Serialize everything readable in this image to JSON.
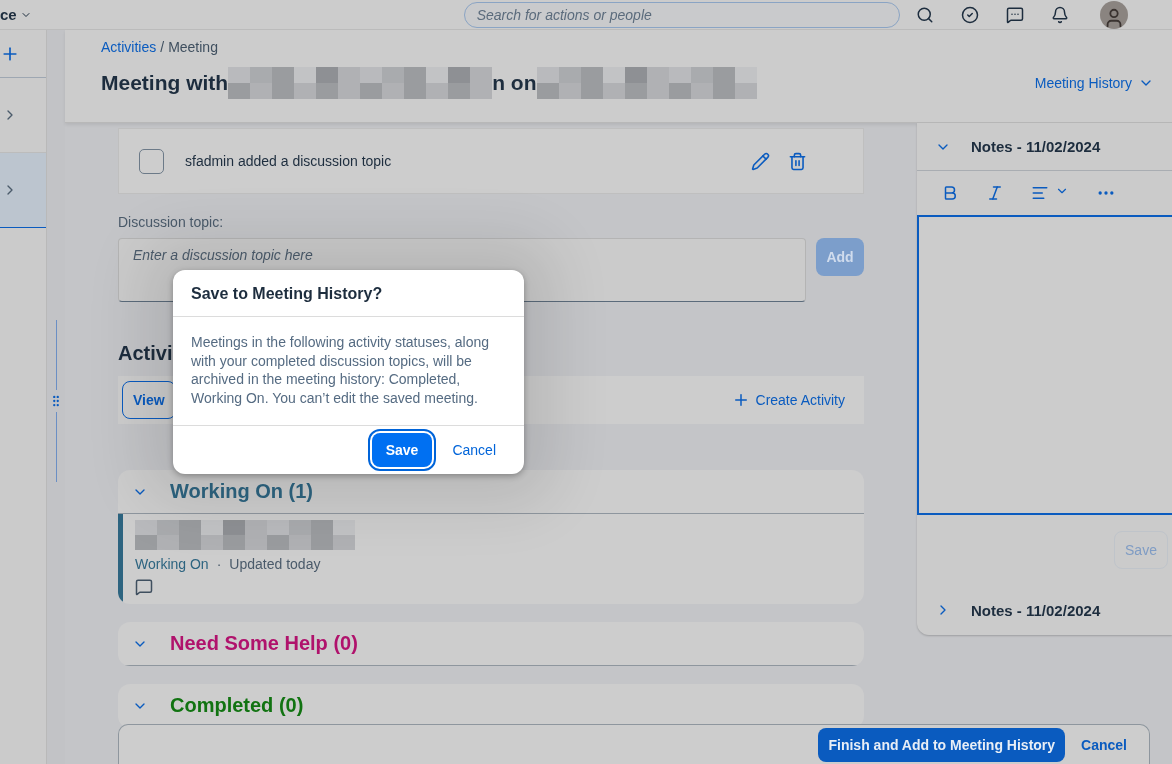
{
  "shell": {
    "title": "ce",
    "search": {
      "placeholder": "Search for actions or people"
    }
  },
  "sidebar": {
    "items": [
      {
        "selected": false
      },
      {
        "selected": true
      }
    ]
  },
  "breadcrumb": {
    "items": [
      {
        "label": "Activities",
        "link": true
      },
      {
        "label": "Meeting",
        "link": false
      }
    ],
    "separator": "/"
  },
  "title": {
    "lead": "Meeting with",
    "middle": "n on"
  },
  "history_menu": {
    "label": "Meeting History"
  },
  "topics": [
    {
      "text": "sfadmin added a discussion topic",
      "checked": false
    }
  ],
  "discussion": {
    "label": "Discussion topic:",
    "placeholder": "Enter a discussion topic here",
    "add_button": {
      "label": "Add",
      "disabled": true
    }
  },
  "activities": {
    "heading": "Activi",
    "view_button": "View",
    "create_button": "Create Activity"
  },
  "groups": [
    {
      "title": "Working On (1)",
      "color": "#2d6480",
      "expanded": true,
      "items": [
        {
          "status": "Working On",
          "separator": "·",
          "updated": "Updated today"
        }
      ]
    },
    {
      "title": "Need Some Help (0)",
      "color": "#b0126c",
      "expanded": true
    },
    {
      "title": "Completed (0)",
      "color": "#117311",
      "expanded": true
    }
  ],
  "notes": [
    {
      "title": "Notes - 11/02/2024",
      "expanded": true,
      "save": {
        "label": "Save",
        "disabled": true
      }
    },
    {
      "title": "Notes - 11/02/2024",
      "expanded": false
    }
  ],
  "footer": {
    "buttons": [
      {
        "label": "Finish and Add to Meeting History",
        "kind": "primary"
      },
      {
        "label": "Cancel",
        "kind": "link"
      }
    ]
  },
  "dialog": {
    "title": "Save to Meeting History?",
    "message": "Meetings in the following activity statuses, along with your completed discussion topics, will be archived in the meeting history: Completed, Working On. You can’t edit the saved meeting.",
    "buttons": [
      {
        "label": "Save",
        "kind": "primary",
        "focused": true
      },
      {
        "label": "Cancel",
        "kind": "link",
        "focused": false
      }
    ]
  }
}
